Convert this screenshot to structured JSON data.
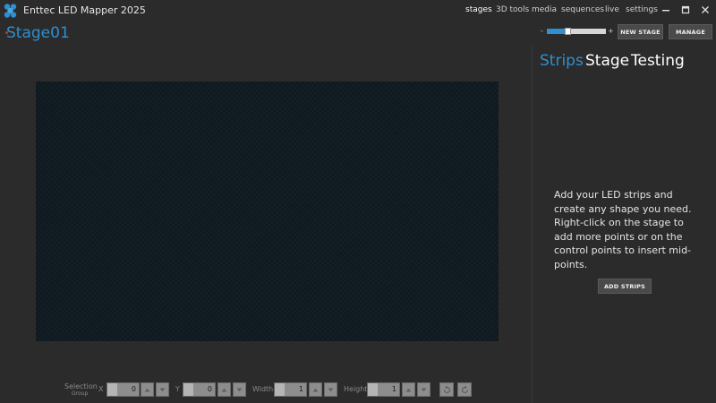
{
  "window": {
    "title": "Enttec LED Mapper 2025"
  },
  "nav": [
    {
      "label": "stages"
    },
    {
      "label": "3D tools"
    },
    {
      "label": "media"
    },
    {
      "label": "sequences"
    },
    {
      "label": "live"
    },
    {
      "label": "settings"
    }
  ],
  "stage": {
    "name": "Stage01"
  },
  "zoom": {
    "minus": "-",
    "plus": "+",
    "level": 0.3
  },
  "buttons": {
    "new_stage": "NEW STAGE",
    "manage": "MANAGE",
    "add_strips": "ADD STRIPS"
  },
  "panel": {
    "tabs": [
      {
        "label": "Strips"
      },
      {
        "label": "Stage"
      },
      {
        "label": "Testing"
      }
    ],
    "help": "Add your LED strips and create any shape you need. Right-click on the stage to add more points or on the control points to insert mid-points."
  },
  "toolbar": {
    "selection_label": "Selection",
    "group_label": "Group",
    "x_label": "X",
    "x_value": "0",
    "y_label": "Y",
    "y_value": "0",
    "width_label": "Width",
    "width_value": "1",
    "height_label": "Height",
    "height_value": "1"
  },
  "colors": {
    "accent": "#2f8fd0",
    "background": "#2b2b2b",
    "canvas": "#0f1a20"
  }
}
